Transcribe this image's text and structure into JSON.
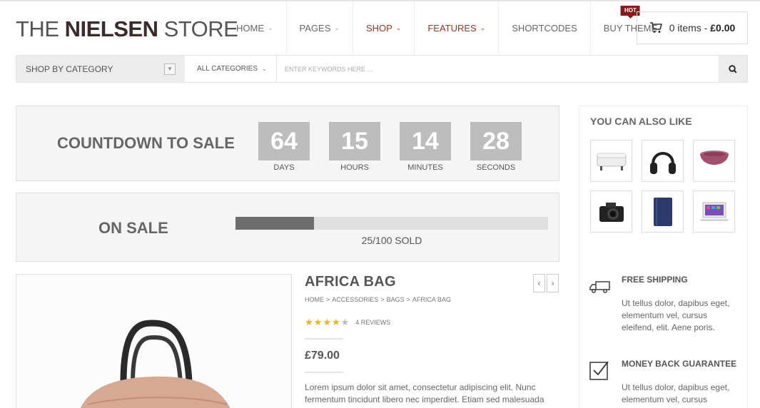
{
  "brand": {
    "logo_light": "THE ",
    "logo_bold": "NIELSEN",
    "logo_rest": " STORE"
  },
  "nav": [
    {
      "label": "HOME",
      "chevron": true,
      "accent": false
    },
    {
      "label": "PAGES",
      "chevron": true,
      "accent": false
    },
    {
      "label": "SHOP",
      "chevron": true,
      "accent": true
    },
    {
      "label": "FEATURES",
      "chevron": true,
      "accent": true
    },
    {
      "label": "SHORTCODES",
      "chevron": false,
      "accent": false
    },
    {
      "label": "BUY THEME",
      "chevron": false,
      "accent": false,
      "badge": "HOT"
    }
  ],
  "cart": {
    "items": "0 items",
    "sep": " - ",
    "total": "£0.00"
  },
  "search": {
    "category_label": "SHOP BY CATEGORY",
    "all_categories": "ALL CATEGORIES",
    "placeholder": "ENTER KEYWORDS HERE ..."
  },
  "countdown": {
    "title": "COUNTDOWN TO SALE",
    "units": [
      {
        "value": "64",
        "label": "DAYS"
      },
      {
        "value": "15",
        "label": "HOURS"
      },
      {
        "value": "14",
        "label": "MINUTES"
      },
      {
        "value": "28",
        "label": "SECONDS"
      }
    ]
  },
  "onsale": {
    "title": "ON SALE",
    "sold": 25,
    "total": 100,
    "text": "25/100 SOLD"
  },
  "product": {
    "title": "AFRICA BAG",
    "breadcrumb": [
      "HOME",
      ">",
      "ACCESSORIES",
      ">",
      "BAGS",
      ">",
      "AFRICA BAG"
    ],
    "rating": 4,
    "rating_max": 5,
    "reviews": "4 REVIEWS",
    "price": "£79.00",
    "description": "Lorem ipsum dolor sit amet, consectetur adipiscing elit. Nunc fermentum tincidunt libero nec imperdiet. Etiam sed malesuada"
  },
  "sidebar": {
    "title": "YOU CAN ALSO LIKE",
    "thumbs": [
      "ottoman-icon",
      "headphones-icon",
      "bowl-icon",
      "camera-icon",
      "tablet-case-icon",
      "laptop-icon"
    ],
    "features": [
      {
        "icon": "truck-icon",
        "title": "FREE SHIPPING",
        "text": "Ut tellus dolor, dapibus eget, elementum vel, cursus eleifend, elit. Aene poris."
      },
      {
        "icon": "checkbox-icon",
        "title": "MONEY BACK GUARANTEE",
        "text": "Ut tellus dolor, dapibus eget, elementum vel, cursus"
      }
    ]
  },
  "colors": {
    "accent": "#a3321f",
    "hot_badge": "#8c1a1a",
    "countdown_box": "#bdbdbd",
    "progress_fill": "#6d6d6d",
    "star": "#f2b01e"
  }
}
